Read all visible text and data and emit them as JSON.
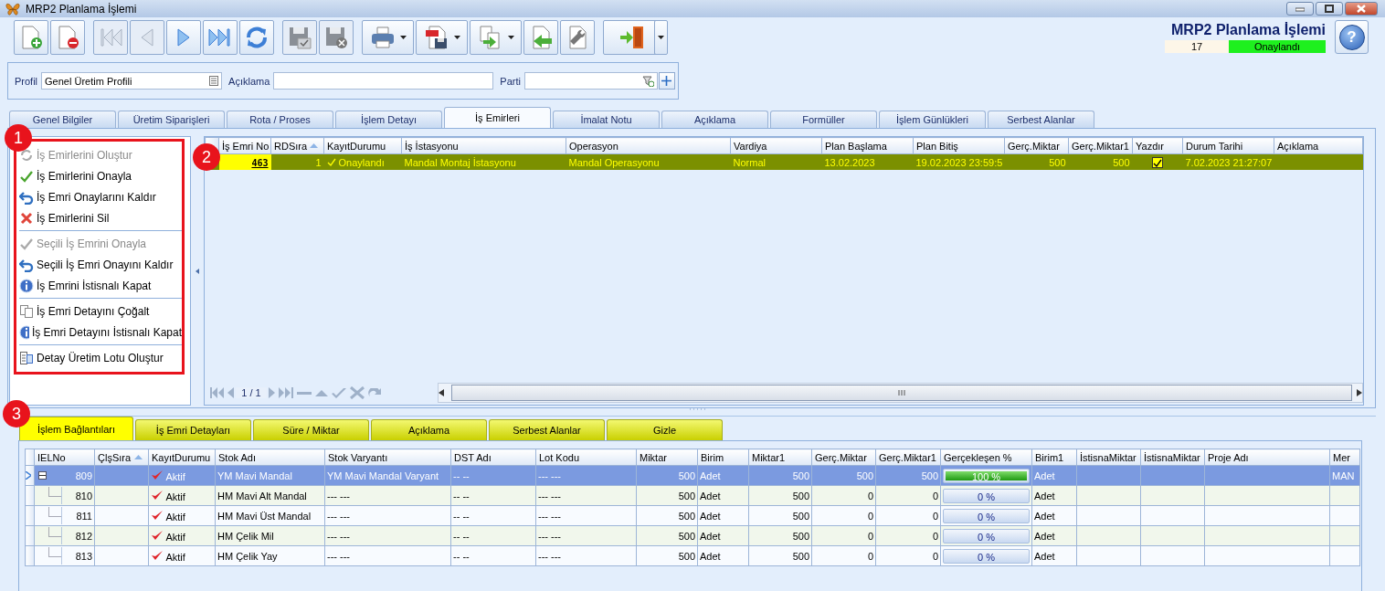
{
  "window": {
    "title": "MRP2 Planlama İşlemi"
  },
  "toolbar": [
    [
      {
        "kind": "new",
        "disabled": false,
        "dropdown": false
      },
      {
        "kind": "delete",
        "disabled": false,
        "dropdown": false
      }
    ],
    [
      {
        "kind": "first",
        "disabled": true,
        "dropdown": false
      },
      {
        "kind": "prev",
        "disabled": true,
        "dropdown": false
      },
      {
        "kind": "next",
        "disabled": false,
        "dropdown": false
      },
      {
        "kind": "last",
        "disabled": false,
        "dropdown": false
      },
      {
        "kind": "refresh",
        "disabled": false,
        "dropdown": false
      }
    ],
    [
      {
        "kind": "save",
        "disabled": true,
        "dropdown": false
      },
      {
        "kind": "discard",
        "disabled": true,
        "dropdown": false
      }
    ],
    [
      {
        "kind": "print",
        "disabled": false,
        "dropdown": true
      },
      {
        "kind": "pdf",
        "disabled": false,
        "dropdown": true
      },
      {
        "kind": "export",
        "disabled": false,
        "dropdown": true
      },
      {
        "kind": "import",
        "disabled": false,
        "dropdown": false
      },
      {
        "kind": "settings",
        "disabled": false,
        "dropdown": false
      }
    ],
    [
      {
        "kind": "exit",
        "disabled": false,
        "dropdown": false
      },
      {
        "kind": "menu",
        "disabled": false,
        "dropdown": true
      }
    ]
  ],
  "header": {
    "title": "MRP2 Planlama İşlemi",
    "number": "17",
    "status": "Onaylandı",
    "help": "?"
  },
  "filters": [
    {
      "label": "Profil",
      "value": "Genel Üretim Profili",
      "kind": "list"
    },
    {
      "label": "Açıklama",
      "kind": "text"
    },
    {
      "label": "Parti",
      "kind": "lookup"
    }
  ],
  "tabs": [
    {
      "label": "Genel Bilgiler",
      "selected": false
    },
    {
      "label": "Üretim Siparişleri",
      "selected": false
    },
    {
      "label": "Rota / Proses",
      "selected": false
    },
    {
      "label": "İşlem Detayı",
      "selected": false
    },
    {
      "label": "İş Emirleri",
      "selected": true
    },
    {
      "label": "İmalat Notu",
      "selected": false
    },
    {
      "label": "Açıklama",
      "selected": false
    },
    {
      "label": "Formüller",
      "selected": false
    },
    {
      "label": "İşlem Günlükleri",
      "selected": false
    },
    {
      "label": "Serbest Alanlar",
      "selected": false
    }
  ],
  "actions": [
    [
      {
        "label": "İş Emirlerini Oluştur",
        "disabled": true
      },
      {
        "label": "İş Emirlerini Onayla",
        "disabled": false
      },
      {
        "label": "İş Emri Onaylarını Kaldır",
        "disabled": false
      },
      {
        "label": "İş Emirlerini Sil",
        "disabled": false
      }
    ],
    [
      {
        "label": "Seçili İş Emrini Onayla",
        "disabled": true
      },
      {
        "label": "Seçili İş Emri Onayını Kaldır",
        "disabled": false
      },
      {
        "label": "İş Emrini İstisnalı Kapat",
        "disabled": false
      }
    ],
    [
      {
        "label": "İş Emri Detayını Çoğalt",
        "disabled": false
      },
      {
        "label": "İş Emri Detayını İstisnalı Kapat",
        "disabled": false
      }
    ],
    [
      {
        "label": "Detay Üretim Lotu Oluştur",
        "disabled": false
      }
    ]
  ],
  "work_orders": {
    "columns": [
      {
        "label": "İş Emri No",
        "kind": "key",
        "sorted": false
      },
      {
        "label": "RDSıra",
        "kind": "number",
        "sorted": true
      },
      {
        "label": "KayıtDurumu",
        "kind": "status",
        "sorted": false
      },
      {
        "label": "İş İstasyonu",
        "kind": "text",
        "sorted": false
      },
      {
        "label": "Operasyon",
        "kind": "text",
        "sorted": false
      },
      {
        "label": "Vardiya",
        "kind": "text",
        "sorted": false
      },
      {
        "label": "Plan Başlama",
        "kind": "text",
        "sorted": false
      },
      {
        "label": "Plan Bitiş",
        "kind": "text",
        "sorted": false
      },
      {
        "label": "Gerç.Miktar",
        "kind": "number",
        "sorted": false
      },
      {
        "label": "Gerç.Miktar1",
        "kind": "number",
        "sorted": false
      },
      {
        "label": "Yazdır",
        "kind": "check",
        "sorted": false
      },
      {
        "label": "Durum Tarihi",
        "kind": "text",
        "sorted": false
      },
      {
        "label": "Açıklama",
        "sorted": false
      }
    ],
    "rows": [
      {
        "selected": true,
        "cells": [
          "463",
          "1",
          "Onaylandı",
          "Mandal Montaj İstasyonu",
          "Mandal Operasyonu",
          "Normal",
          "13.02.2023",
          "19.02.2023 23:59:5",
          "500",
          "500",
          {
            "checked": true
          },
          "7.02.2023 21:27:07",
          ""
        ]
      }
    ]
  },
  "pager": "1 / 1",
  "detail_tabs": [
    {
      "label": "İşlem Bağlantıları",
      "selected": true
    },
    {
      "label": "İş Emri Detayları",
      "selected": false
    },
    {
      "label": "Süre / Miktar",
      "selected": false
    },
    {
      "label": "Açıklama",
      "selected": false
    },
    {
      "label": "Serbest Alanlar",
      "selected": false
    },
    {
      "label": "Gizle",
      "selected": false
    }
  ],
  "links": {
    "columns": [
      {
        "label": "IELNo",
        "kind": "tree",
        "sorted": false
      },
      {
        "label": "ÇlşSıra",
        "sorted": true
      },
      {
        "label": "KayıtDurumu",
        "kind": "status",
        "sorted": false
      },
      {
        "label": "Stok Adı",
        "kind": "text",
        "sorted": false
      },
      {
        "label": "Stok Varyantı",
        "kind": "text",
        "sorted": false
      },
      {
        "label": "DST Adı",
        "kind": "text",
        "sorted": false
      },
      {
        "label": "Lot Kodu",
        "kind": "text",
        "sorted": false
      },
      {
        "label": "Miktar",
        "kind": "number",
        "sorted": false
      },
      {
        "label": "Birim",
        "kind": "text",
        "sorted": false
      },
      {
        "label": "Miktar1",
        "kind": "number",
        "sorted": false
      },
      {
        "label": "Gerç.Miktar",
        "kind": "number",
        "sorted": false
      },
      {
        "label": "Gerç.Miktar1",
        "kind": "number",
        "sorted": false
      },
      {
        "label": "Gerçekleşen %",
        "kind": "progress",
        "sorted": false
      },
      {
        "label": "Birim1",
        "kind": "text",
        "sorted": false
      },
      {
        "label": "İstisnaMiktar",
        "sorted": false
      },
      {
        "label": "İstisnaMiktar",
        "sorted": false
      },
      {
        "label": "Proje Adı",
        "sorted": false
      },
      {
        "label": "Mer",
        "kind": "text",
        "sorted": false
      }
    ],
    "rows": [
      {
        "selected": true,
        "expanded": true,
        "cells": [
          "809",
          "",
          "Aktif",
          "YM Mavi Mandal",
          "YM Mavi Mandal Varyant",
          "-- --",
          "--- ---",
          "500",
          "Adet",
          "500",
          "500",
          "500",
          {
            "level": 1,
            "label": "100 %"
          },
          "Adet",
          "",
          "",
          "",
          "MAN"
        ],
        "children": [
          {
            "selected": false,
            "cells": [
              "810",
              "",
              "Aktif",
              "HM Mavi Alt Mandal",
              "--- ---",
              "-- --",
              "--- ---",
              "500",
              "Adet",
              "500",
              "0",
              "0",
              {
                "level": 0,
                "label": "0 %"
              },
              "Adet",
              "",
              "",
              "",
              ""
            ]
          },
          {
            "selected": false,
            "cells": [
              "811",
              "",
              "Aktif",
              "HM Mavi Üst Mandal",
              "--- ---",
              "-- --",
              "--- ---",
              "500",
              "Adet",
              "500",
              "0",
              "0",
              {
                "level": 0,
                "label": "0 %"
              },
              "Adet",
              "",
              "",
              "",
              ""
            ]
          },
          {
            "selected": false,
            "cells": [
              "812",
              "",
              "Aktif",
              "HM Çelik Mil",
              "--- ---",
              "-- --",
              "--- ---",
              "500",
              "Adet",
              "500",
              "0",
              "0",
              {
                "level": 0,
                "label": "0 %"
              },
              "Adet",
              "",
              "",
              "",
              ""
            ]
          },
          {
            "selected": false,
            "cells": [
              "813",
              "",
              "Aktif",
              "HM Çelik Yay",
              "--- ---",
              "-- --",
              "--- ---",
              "500",
              "Adet",
              "500",
              "0",
              "0",
              {
                "level": 0,
                "label": "0 %"
              },
              "Adet",
              "",
              "",
              "",
              ""
            ]
          }
        ]
      }
    ]
  },
  "annotations": [
    {
      "label": "1"
    },
    {
      "label": "2"
    },
    {
      "label": "3"
    }
  ]
}
